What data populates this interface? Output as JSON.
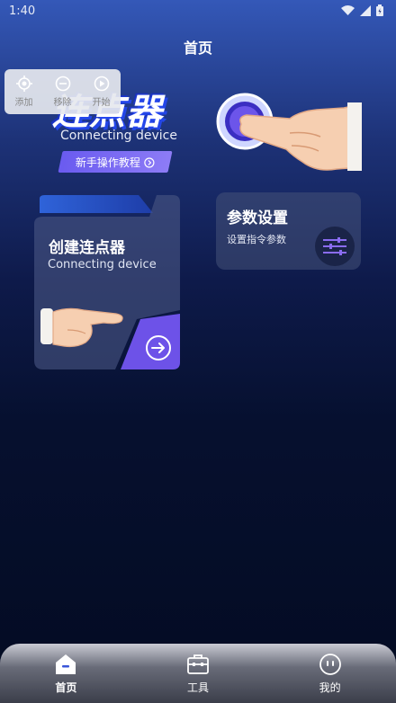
{
  "status_bar": {
    "time": "1:40"
  },
  "header": {
    "title": "首页"
  },
  "floating_toolbar": {
    "items": [
      {
        "label": "添加",
        "icon": "crosshair-icon"
      },
      {
        "label": "移除",
        "icon": "minus-circle-icon"
      },
      {
        "label": "开始",
        "icon": "play-circle-icon"
      }
    ]
  },
  "hero": {
    "title": "连点器",
    "subtitle": "Connecting device",
    "tutorial_label": "新手操作教程"
  },
  "create_card": {
    "title": "创建连点器",
    "subtitle": "Connecting device"
  },
  "settings_card": {
    "title": "参数设置",
    "subtitle": "设置指令参数"
  },
  "bottom_nav": {
    "items": [
      {
        "label": "首页",
        "icon": "home-icon",
        "active": true
      },
      {
        "label": "工具",
        "icon": "toolbox-icon",
        "active": false
      },
      {
        "label": "我的",
        "icon": "profile-icon",
        "active": false
      }
    ]
  },
  "colors": {
    "accent": "#7b6cf4",
    "bg_top": "#3458b8",
    "bg_bottom": "#040b22"
  }
}
